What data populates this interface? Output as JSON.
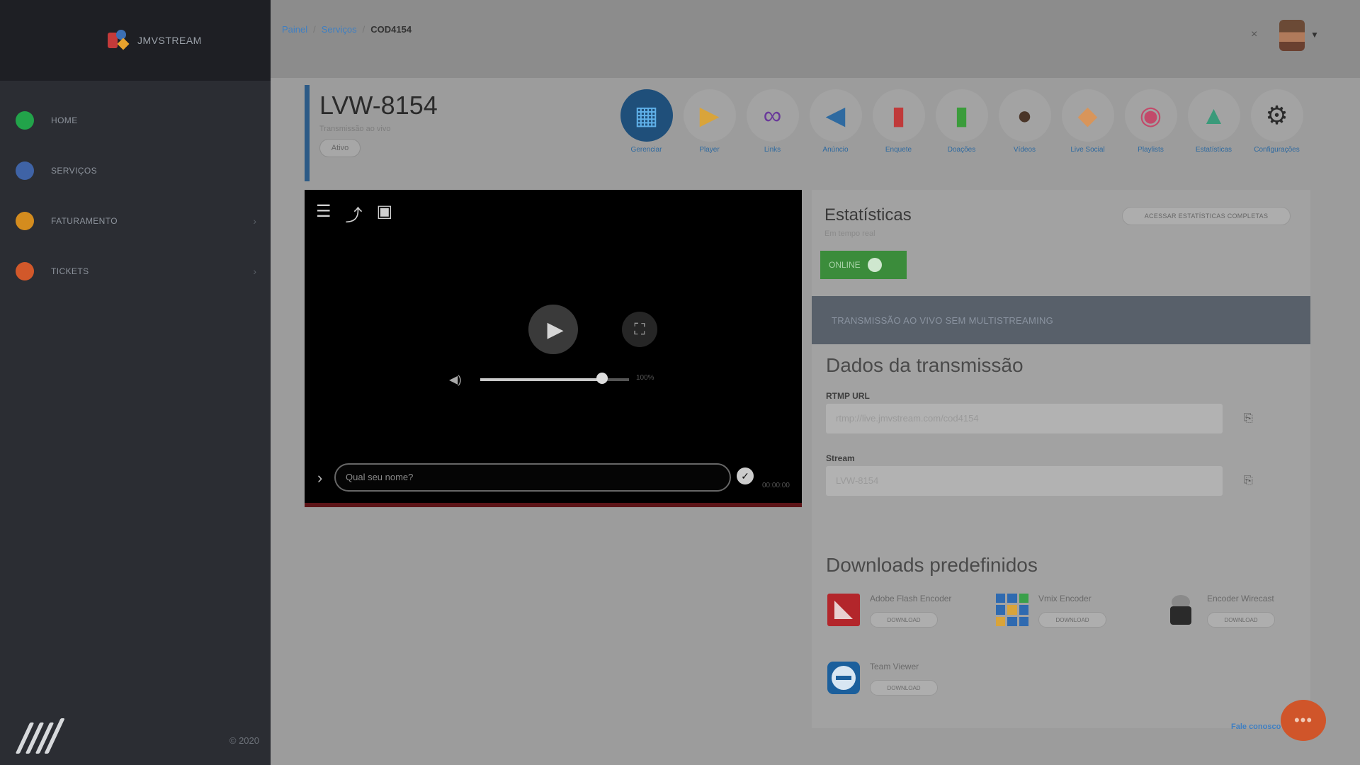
{
  "brand": {
    "name": "JMVSTREAM"
  },
  "sidebar": {
    "items": [
      {
        "label": "HOME",
        "color": "#22a34a",
        "chevron": false
      },
      {
        "label": "SERVIÇOS",
        "color": "#3f63a6",
        "chevron": false
      },
      {
        "label": "FATURAMENTO",
        "color": "#d48c1e",
        "chevron": true
      },
      {
        "label": "TICKETS",
        "color": "#d2582a",
        "chevron": true
      }
    ],
    "footer_copyright": "© 2020"
  },
  "topbar": {
    "breadcrumb": [
      "Painel",
      "Serviços",
      "COD4154"
    ],
    "close_symbol": "×"
  },
  "service": {
    "title": "LVW-8154",
    "subtitle": "Transmissão ao vivo",
    "view_button": "Ativo"
  },
  "toolbar": [
    {
      "label": "Gerenciar",
      "icon": "grid-icon",
      "glyph": "▦",
      "color": "#5fb0e8",
      "active": true
    },
    {
      "label": "Player",
      "icon": "play-icon",
      "glyph": "▶",
      "color": "#d9a43a",
      "active": false
    },
    {
      "label": "Links",
      "icon": "link-icon",
      "glyph": "∞",
      "color": "#6a3a9a",
      "active": false
    },
    {
      "label": "Anúncio",
      "icon": "megaphone-icon",
      "glyph": "📣",
      "color": "#2f6aa0",
      "active": false
    },
    {
      "label": "Enquete",
      "icon": "poll-icon",
      "glyph": "▮",
      "color": "#c03a3a",
      "active": false
    },
    {
      "label": "Doações",
      "icon": "donation-icon",
      "glyph": "▮",
      "color": "#3b9c3b",
      "active": false
    },
    {
      "label": "Vídeos",
      "icon": "film-reel-icon",
      "glyph": "●",
      "color": "#4a3528",
      "active": false
    },
    {
      "label": "Live Social",
      "icon": "social-icon",
      "glyph": "◆",
      "color": "#d8955a",
      "active": false
    },
    {
      "label": "Playlists",
      "icon": "playlist-icon",
      "glyph": "◉",
      "color": "#c24a6a",
      "active": false
    },
    {
      "label": "Estatísticas",
      "icon": "stats-icon",
      "glyph": "▲",
      "color": "#3a9a7a",
      "active": false
    },
    {
      "label": "Configurações",
      "icon": "gear-icon",
      "glyph": "⚙",
      "color": "#2a2a2a",
      "active": false
    }
  ],
  "player": {
    "comment_placeholder": "Qual seu nome?",
    "volume_level": 0.82,
    "volume_text": "100%",
    "time_text": "00:00:00"
  },
  "stats": {
    "title": "Estatísticas",
    "subtitle": "Em tempo real",
    "full_button": "ACESSAR ESTATÍSTICAS COMPLETAS",
    "status_badge": "ONLINE"
  },
  "banner": {
    "text": "TRANSMISSÃO AO VIVO SEM MULTISTREAMING"
  },
  "transmission": {
    "title": "Dados da transmissão",
    "rtmp_label": "RTMP URL",
    "rtmp_value": "rtmp://live.jmvstream.com/cod4154",
    "stream_label": "Stream",
    "stream_value": "LVW-8154"
  },
  "downloads": {
    "title": "Downloads predefinidos",
    "download_label": "DOWNLOAD",
    "items": [
      {
        "name": "Adobe Flash Encoder"
      },
      {
        "name": "Vmix Encoder"
      },
      {
        "name": "Encoder Wirecast"
      },
      {
        "name": "Team Viewer"
      }
    ]
  },
  "chat": {
    "label": "Fale conosco",
    "bubble": "•••"
  }
}
